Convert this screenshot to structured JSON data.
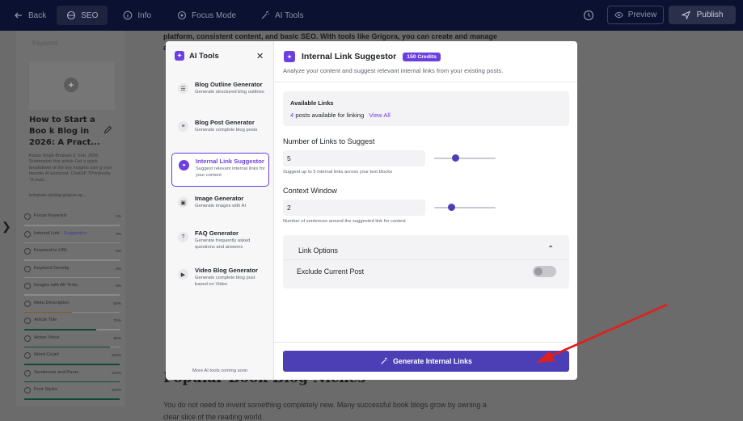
{
  "topbar": {
    "back": "Back",
    "seo": "SEO",
    "info": "Info",
    "focus_mode": "Focus Mode",
    "ai_tools": "AI Tools",
    "preview": "Preview",
    "publish": "Publish"
  },
  "sidebar": {
    "keyword_placeholder": "Keyword",
    "post_title": "How to Start a Boo k Blog in 2026: A Pract...",
    "post_meta": "Karan Singh Bhakuni 3. Feb, 2026 Summarize this article Get a quick breakdown of the key insights usin g your favorite AI assistant. ChatGP TPerplexity \"A read...",
    "post_url": "template-njsdag.grigora.sp...",
    "checks": [
      {
        "label": "Focus Keyword",
        "score": "0%",
        "fill": 0,
        "color": "green"
      },
      {
        "label": "Internal Link · ",
        "highlight": "Suggestion",
        "score": "0%",
        "fill": 0,
        "color": "green"
      },
      {
        "label": "Keyword in URL",
        "score": "0%",
        "fill": 0,
        "color": "green"
      },
      {
        "label": "Keyword Density",
        "score": "0%",
        "fill": 0,
        "color": "green"
      },
      {
        "label": "Images with Alt Texts",
        "score": "0%",
        "fill": 0,
        "color": "green"
      },
      {
        "label": "Meta Description",
        "score": "50%",
        "fill": 0.5,
        "color": "orange"
      },
      {
        "label": "Article Title",
        "score": "75%",
        "fill": 0.75,
        "color": "green"
      },
      {
        "label": "Active Voice",
        "score": "90%",
        "fill": 0.9,
        "color": "green"
      },
      {
        "label": "Word Count",
        "score": "100%",
        "fill": 1,
        "color": "green"
      },
      {
        "label": "Sentences and Paras",
        "score": "100%",
        "fill": 1,
        "color": "green"
      },
      {
        "label": "Font Styles",
        "score": "100%",
        "fill": 1,
        "color": "green"
      }
    ]
  },
  "editor": {
    "para1": "platform, consistent content, and basic SEO. With tools like Grigora, you can create and manage a",
    "heading": "Popular Book Blog Niches",
    "para2": "You do not need to invent something completely new. Many successful book blogs grow by owning a clear slice of the reading world."
  },
  "modal": {
    "left": {
      "title": "AI Tools",
      "tools": [
        {
          "title": "Blog Outline Generator",
          "desc": "Generate structured blog outlines",
          "icon": "document-icon"
        },
        {
          "title": "Blog Post Generator",
          "desc": "Generate complete blog posts",
          "icon": "article-icon"
        },
        {
          "title": "Internal Link Suggestor",
          "desc": "Suggest relevant internal links for your content",
          "icon": "link-icon"
        },
        {
          "title": "Image Generator",
          "desc": "Generate images with AI",
          "icon": "image-icon"
        },
        {
          "title": "FAQ Generator",
          "desc": "Generate frequently asked questions and answers",
          "icon": "question-icon"
        },
        {
          "title": "Video Blog Generator",
          "desc": "Generate complete blog post based on Video",
          "icon": "video-icon"
        }
      ],
      "footer": "More AI tools coming soon"
    },
    "right": {
      "title": "Internal Link Suggestor",
      "credits": "150 Credits",
      "subtitle": "Analyze your content and suggest relevant internal links from your existing posts.",
      "available_label": "Available Links",
      "available_count": "4",
      "available_text": "posts available for linking",
      "view_all": "View All",
      "links_label": "Number of Links to Suggest",
      "links_value": "5",
      "links_slider": 0.35,
      "links_hint": "Suggest up to 5 internal links across your text blocks",
      "context_label": "Context Window",
      "context_value": "2",
      "context_slider": 0.28,
      "context_hint": "Number of sentences around the suggested link for context",
      "options_title": "Link Options",
      "exclude_label": "Exclude Current Post",
      "generate": "Generate Internal Links"
    }
  },
  "colors": {
    "accent": "#6b3fe0",
    "button": "#4c3fb5",
    "arrow": "#e0201c"
  }
}
